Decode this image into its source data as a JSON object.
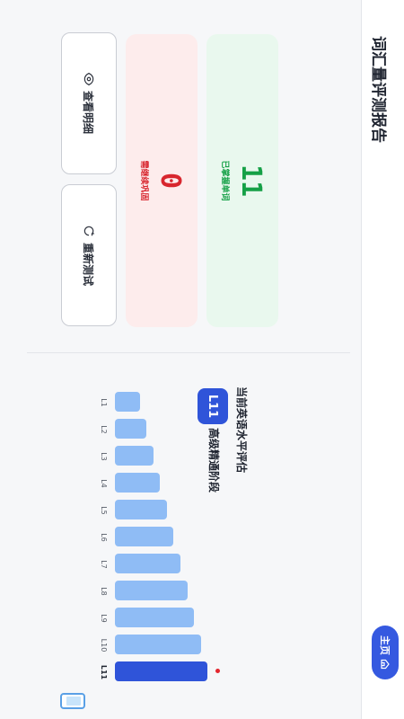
{
  "header": {
    "title": "词汇量评测报告",
    "home_label": "主页"
  },
  "stats": {
    "mastered_count": "11",
    "mastered_label": "已掌握单词",
    "review_count": "0",
    "review_label": "需继续巩固"
  },
  "actions": {
    "detail_label": "查看明细",
    "retest_label": "重新测试"
  },
  "assessment": {
    "heading": "当前英语水平评估",
    "level_badge": "L11",
    "stage_label": "高级精通阶段"
  },
  "levels_chart": {
    "levels": [
      "L1",
      "L2",
      "L3",
      "L4",
      "L5",
      "L6",
      "L7",
      "L8",
      "L9",
      "L10",
      "L11"
    ],
    "relative_values": [
      0.22,
      0.28,
      0.34,
      0.4,
      0.46,
      0.52,
      0.58,
      0.64,
      0.7,
      0.76,
      0.82
    ],
    "current_level": "L11",
    "colors": {
      "bar": "#8fbcf5",
      "current": "#2f54d9",
      "marker": "#e3262e"
    }
  },
  "colors": {
    "mastered": "#15a046",
    "review": "#d8262e",
    "accent": "#2f54d9"
  }
}
